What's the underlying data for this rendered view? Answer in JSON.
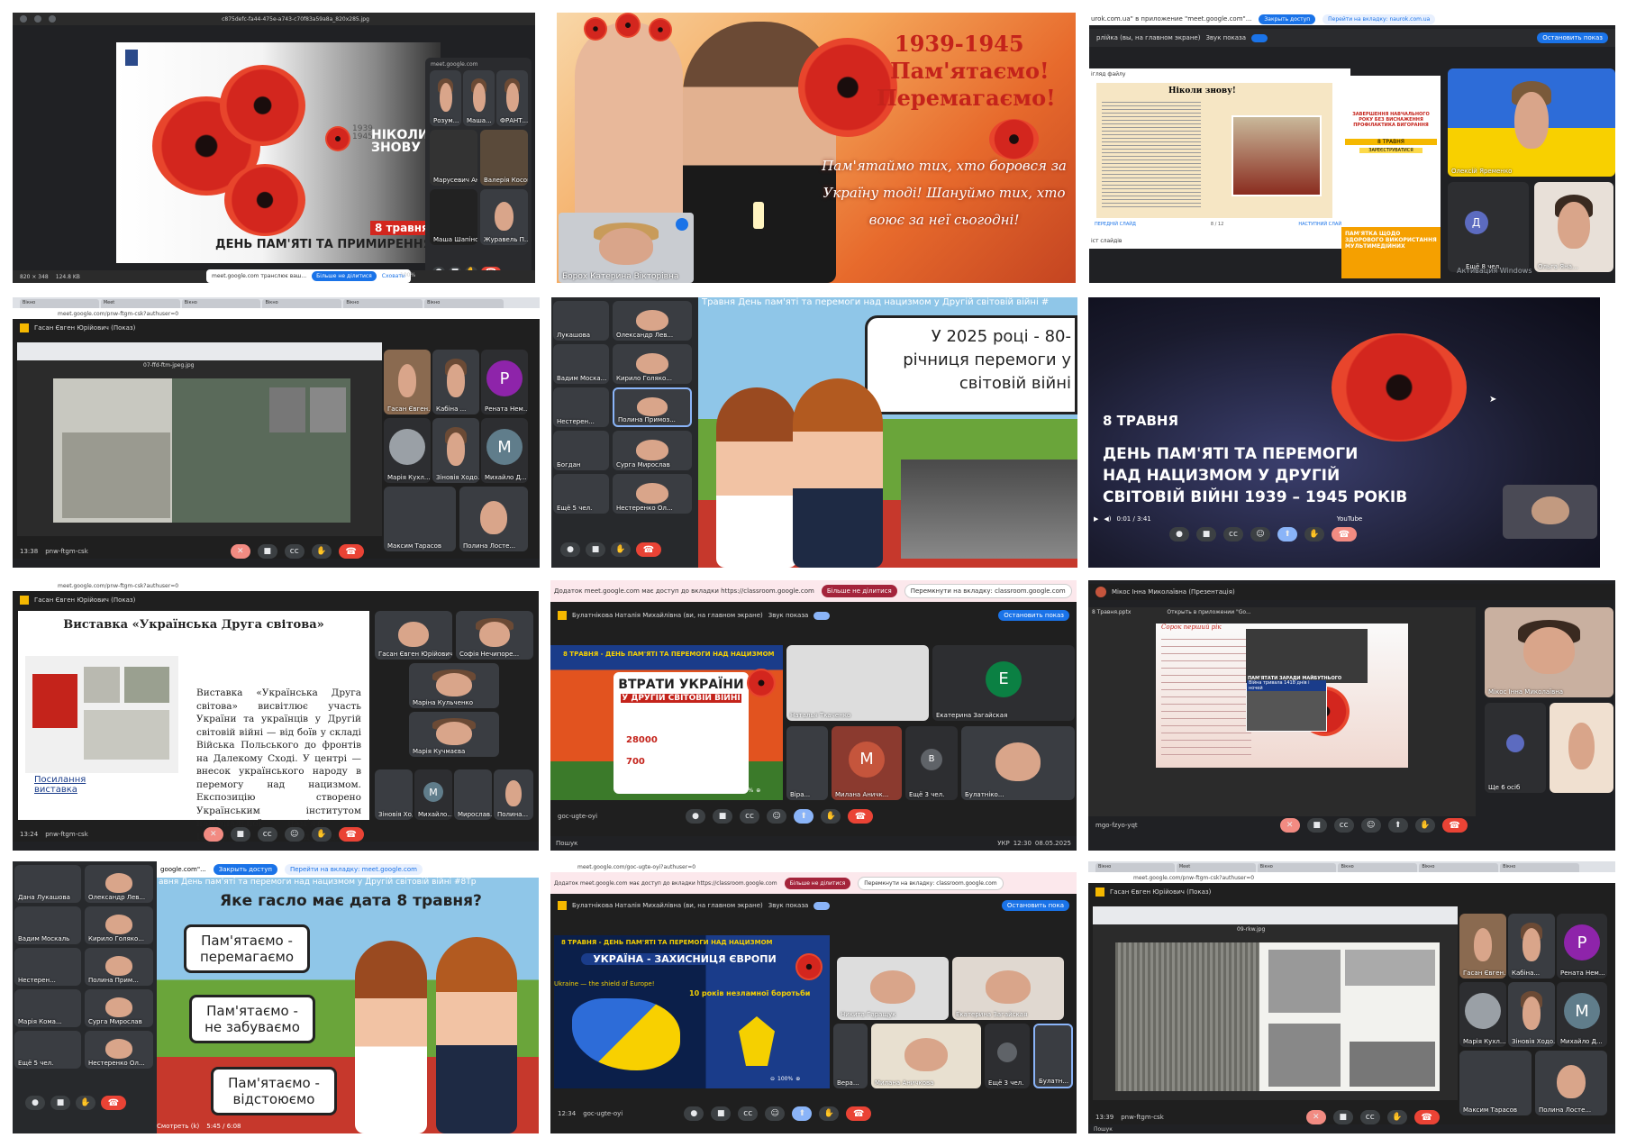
{
  "t1": {
    "filename": "c875defc-fa44-475e-a743-c70f83a59a8a_820x285.jpg",
    "slide_years": [
      "1939",
      "1945"
    ],
    "slide_slogan": [
      "НІКОЛИ",
      "ЗНОВУ"
    ],
    "date_badge": "8 травня",
    "banner": "ДЕНЬ ПАМ'ЯТІ ТА ПРИМИРЕННЯ",
    "meet_url": "meet.google.com",
    "share_notice": "meet.google.com транслює ваш...",
    "stop_share": "Більше не ділитися",
    "hide": "Сховати",
    "zoom": "100%",
    "size_info": "820 × 348",
    "file_size": "124.8 KB",
    "participants": [
      "Розум...",
      "Маша...",
      "ФРАНТ...",
      "Марусевич Ана",
      "Валерія Косогор",
      "Маша Шапіновсь...",
      "Журавель П..."
    ]
  },
  "t2": {
    "title_years": "1939-1945",
    "line1": "Пам'ятаємо!",
    "line2": "Перемагаємо!",
    "script_text": "Пам'ятаймо тих, хто боровся за Україну тоді! Шануймо тих, хто воює за неї сьогодні!",
    "self_name": "Борох Катерина Вікторівна"
  },
  "t3": {
    "chrome_notice": "urok.com.ua\" в приложение \"meet.google.com\"...",
    "close_access": "Закрыть доступ",
    "go_tab": "Перейти на вкладку: naurok.com.ua",
    "presenter": "Олексій Яременко",
    "screen_label": "рлійка (вы, на главном экране)",
    "sound": "Звук показа",
    "stop_show": "Остановить показ",
    "doc_title": "Ніколи знову!",
    "file_crumb": "ігляд файлу",
    "prev_slide": "ПЕРЕДНІЙ СЛАЙД",
    "next_slide": "НАСТУПНИЙ СЛАЙД",
    "page_count": "8 / 12",
    "slide_list": "іст слайдів",
    "promo1": "ЗАВЕРШЕННЯ НАВЧАЛЬНОГО РОКУ БЕЗ ВИСНАЖЕННЯ ПРОФІЛАКТИКА ВИГОРАННЯ",
    "promo_date": "8 ТРАВНЯ",
    "promo_btn": "ЗАРЕЄСТРУВАТИСЯ",
    "promo2": "ПАМ'ЯТКА ЩОДО ЗДОРОВОГО ВИКОРИСТАННЯ МУЛЬТИМЕДІЙНИХ",
    "more_people": "Ещё 8 чел.",
    "avatar_letter": "Д",
    "watermark": "Активация Windows",
    "participant2": "Ольга Яна..."
  },
  "t4": {
    "presenter_hdr": "Гасан Євген Юрійович (Показ)",
    "url": "meet.google.com/pnw-ftgm-csk?authuser=0",
    "image_tab": "07-ffd-ftm-jpeg.jpg",
    "names": [
      "Гасан Євген...",
      "Кабіна ...",
      "Рената Нем...",
      "Марія Кухл...",
      "Зіновія Ходо...",
      "Михайло Д...",
      "Максим Тарасов",
      "Полина Лосте..."
    ],
    "time": "13:38",
    "code": "pnw-ftgm-csk",
    "letters": [
      "P",
      "M"
    ]
  },
  "t5": {
    "marquee": "Травня День пам'яті та перемоги над нацизмом у Другій світовій війні #",
    "speech": [
      "У 2025 році - 80-",
      "річниця перемоги у",
      "світовій війні"
    ],
    "names": [
      "Лукашова",
      "Олександр Лев...",
      "Вадим Моска...",
      "Кирило Голяко...",
      "Нестерен...",
      "Полина Примоз...",
      "Богдан",
      "Сурга Мирослав",
      "Ещё 5 чел.",
      "Нестеренко Ол..."
    ]
  },
  "t6": {
    "date": "8 ТРАВНЯ",
    "line1": "ДЕНЬ ПАМ'ЯТІ ТА ПЕРЕМОГИ",
    "line2": "НАД НАЦИЗМОМ У ДРУГІЙ",
    "line3": "СВІТОВІЙ ВІЙНІ 1939 – 1945 РОКІВ",
    "player_time": "0:01 / 3:41",
    "yt": "YouTube"
  },
  "t7": {
    "url": "meet.google.com/pnw-ftgm-csk?authuser=0",
    "presenter_hdr": "Гасан Євген Юрійович (Показ)",
    "slide_title": "Виставка «Українська Друга світова»",
    "slide_body": "Виставка «Українська Друга світова» висвітлює участь України та українців у Другій світовій війні — від боїв у складі Війська Польського до фронтів на Далекому Сході. У центрі — внесок українського народу в перемогу над нацизмом. Експозицію створено Українським інститутом національної пам'яті та Центром досліджень визвольного руху.",
    "link": "Посилання виставка",
    "names": [
      "Гасан Євген Юрійович",
      "Софія Нечипоре...",
      "Маріна Кульченко",
      "Марія Кучмаєва",
      "Зіновія Ход...",
      "Михайло...",
      "Мирослав...",
      "Полина..."
    ],
    "time": "13:24",
    "code": "pnw-ftgm-csk",
    "letter": "M"
  },
  "t8": {
    "chrome_notice": "Додаток meet.google.com має доступ до вкладки https://classroom.google.com",
    "stop_share": "Більше не ділитися",
    "go_tab": "Перемкнути на вкладку: classroom.google.com",
    "presenter": "Булатнікова Наталія Михайлівна (ви, на главном экране)",
    "sound": "Звук показа",
    "stop_show": "Остановить показ",
    "slide_hdr": "8 ТРАВНЯ - ДЕНЬ ПАМ'ЯТІ ТА ПЕРЕМОГИ НАД НАЦИЗМОМ",
    "loss_title1": "ВТРАТИ УКРАЇНИ",
    "loss_title2": "У ДРУГІЙ СВІТОВІЙ ВІЙНІ",
    "n1": "28000",
    "n2": "700",
    "names": [
      "Наталья Ткаченко",
      "Екатерина Загайская",
      "Віра...",
      "Милана Аничк...",
      "Ещё 3 чел.",
      "Булатніко..."
    ],
    "letters": [
      "E",
      "M",
      "B"
    ],
    "zoom": "100%",
    "code": "goc-ugte-oyi",
    "search": "Пошук",
    "clock": "12:30",
    "date": "08.05.2025",
    "lang": "УКР"
  },
  "t9": {
    "presenter_hdr": "Мікос Інна Миколаївна (Презентація)",
    "file": "8 Травня.pptx",
    "open_with": "Открыть в приложении \"Go...",
    "poem_title": "Сорок перший рік",
    "poster": "ПАМ'ЯТАТИ ЗАРАДИ МАЙБУТНЬОГО",
    "caption": "Війна тривала 1418 днів і ночей",
    "names": [
      "Мікос Інна Миколаївна",
      "Ще 6 осіб"
    ],
    "code": "mgo-fzyo-yqt",
    "letter": "M"
  },
  "t10": {
    "notice": "google.com\"...",
    "close_access": "Закрыть доступ",
    "go_tab": "Перейти на вкладку: meet.google.com",
    "marquee": "авня День пам'яті та перемоги над нацизмом у Другій світовій війні #8Тр",
    "question": "Яке гасло має дата 8 травня?",
    "answers": [
      "Пам'ятаємо - перемагаємо",
      "Пам'ятаємо - не забуваємо",
      "Пам'ятаємо - відстоюємо"
    ],
    "names": [
      "Дана Лукашова",
      "Олександр Лев...",
      "Вадим Москаль",
      "Кирило Голяко...",
      "Нестерен...",
      "Полина Прим...",
      "Марія Кома...",
      "Сурга Мирослав",
      "Ещё 5 чел.",
      "Нестеренко Ол..."
    ],
    "watch": "Смотреть (k)",
    "player_time": "5:45 / 6:08"
  },
  "t11": {
    "url": "meet.google.com/goc-ugte-oyi?authuser=0",
    "chrome_notice": "Додаток meet.google.com має доступ до вкладки https://classroom.google.com",
    "stop_share": "Більше не ділитися",
    "go_tab": "Перемкнути на вкладку: classroom.google.com",
    "presenter": "Булатнікова Наталія Михайлівна (ви, на главном экране)",
    "sound": "Звук показа",
    "stop_show": "Остановить пока",
    "slide_hdr": "8 ТРАВНЯ - ДЕНЬ ПАМ'ЯТІ ТА ПЕРЕМОГИ НАД НАЦИЗМОМ",
    "slide_title": "УКРАЇНА - ЗАХИСНИЦЯ ЄВРОПИ",
    "shield": "Ukraine — the shield of Europe!",
    "years": "10 років незламної боротьби",
    "names": [
      "Никита Гаращук",
      "Екатерина Загайская",
      "Вера...",
      "Милана Аничкова",
      "Ещё 3 чел.",
      "Булатн..."
    ],
    "zoom": "100%",
    "time": "12:34",
    "code": "goc-ugte-oyi"
  },
  "t12": {
    "url": "meet.google.com/pnw-ftgm-csk?authuser=0",
    "presenter_hdr": "Гасан Євген Юрійович (Показ)",
    "image_tab": "09-rkw.jpg",
    "names": [
      "Гасан Євген...",
      "Кабіна...",
      "Рената Нем...",
      "Марія Кухл...",
      "Зіновія Ходо...",
      "Михайло Д...",
      "Максим Тарасов",
      "Полина Лосте..."
    ],
    "letters": [
      "P",
      "M"
    ],
    "time": "13:39",
    "code": "pnw-ftgm-csk",
    "search": "Пошук"
  },
  "colors": {
    "poppy": "#d3261e",
    "meet_dark": "#1f1f1f",
    "meet_blue": "#1a73e8",
    "end_call": "#ea4335"
  }
}
